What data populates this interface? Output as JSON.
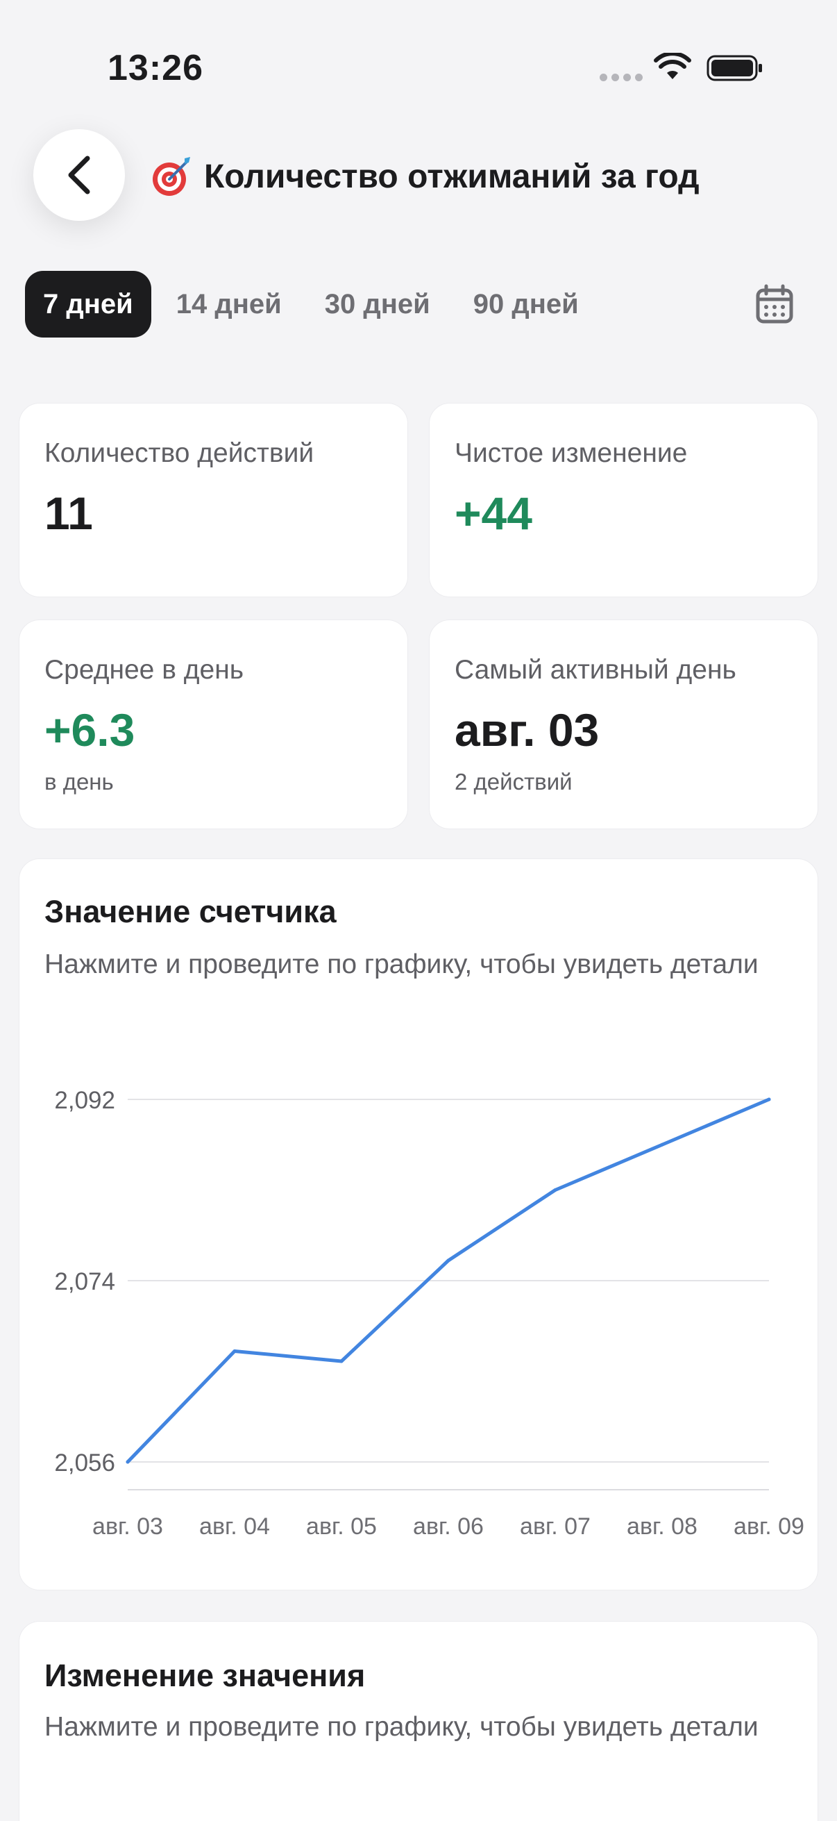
{
  "status_bar": {
    "time": "13:26"
  },
  "header": {
    "title": "Количество отжиманий за год"
  },
  "tabs": [
    {
      "label": "7 дней",
      "active": true
    },
    {
      "label": "14 дней",
      "active": false
    },
    {
      "label": "30 дней",
      "active": false
    },
    {
      "label": "90 дней",
      "active": false
    }
  ],
  "stats": {
    "actions": {
      "label": "Количество действий",
      "value": "11"
    },
    "net_change": {
      "label": "Чистое изменение",
      "value": "+44"
    },
    "avg_per_day": {
      "label": "Среднее в день",
      "value": "+6.3",
      "sub": "в день"
    },
    "most_active": {
      "label": "Самый активный день",
      "value": "авг. 03",
      "sub": "2 действий"
    }
  },
  "counter_chart": {
    "title": "Значение счетчика",
    "hint": "Нажмите и проведите по графику, чтобы увидеть детали"
  },
  "change_chart": {
    "title": "Изменение значения",
    "hint": "Нажмите и проведите по графику, чтобы увидеть детали"
  },
  "colors": {
    "line": "#4285e0",
    "positive": "#1f8a5b",
    "active_tab": "#1c1c1e"
  },
  "chart_data": {
    "type": "line",
    "categories": [
      "авг. 03",
      "авг. 04",
      "авг. 05",
      "авг. 06",
      "авг. 07",
      "авг. 08",
      "авг. 09"
    ],
    "y_ticks": [
      "2,092",
      "2,074",
      "2,056"
    ],
    "y_tick_values": [
      2092,
      2074,
      2056
    ],
    "ylim": [
      2056,
      2092
    ],
    "series": [
      {
        "values": [
          2056,
          2067,
          2066,
          2076,
          2083,
          2087.5,
          2092
        ]
      }
    ],
    "grid": true
  }
}
